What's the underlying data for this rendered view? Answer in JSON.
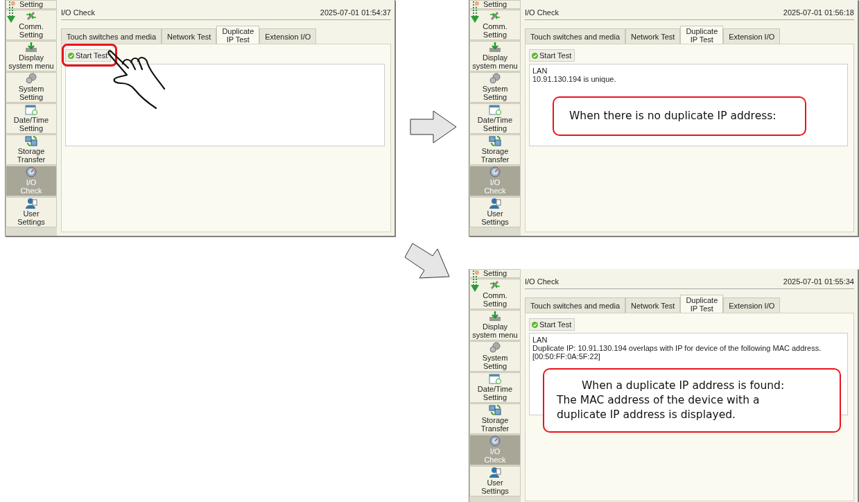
{
  "screens": [
    {
      "title": "I/O Check",
      "datetime": "2025-07-01  01:54:37",
      "sidebar": {
        "items": [
          {
            "label": "Setting",
            "selected": false
          },
          {
            "label": "Comm.\nSetting",
            "selected": false
          },
          {
            "label": "Display\nsystem menu",
            "selected": false
          },
          {
            "label": "System\nSetting",
            "selected": false
          },
          {
            "label": "Date/Time\nSetting",
            "selected": false
          },
          {
            "label": "Storage\nTransfer",
            "selected": false
          },
          {
            "label": "I/O\nCheck",
            "selected": true
          },
          {
            "label": "User\nSettings",
            "selected": false
          }
        ]
      },
      "tabs": [
        {
          "label": "Touch switches and media",
          "selected": false
        },
        {
          "label": "Network Test",
          "selected": false
        },
        {
          "label": "Duplicate\nIP Test",
          "selected": true
        },
        {
          "label": "Extension I/O",
          "selected": false
        }
      ],
      "start_button": {
        "label": "Start Test",
        "highlighted": true
      },
      "tapped": true
    },
    {
      "title": "I/O Check",
      "datetime": "2025-07-01  01:56:18",
      "sidebar": {
        "items": [
          {
            "label": "Setting",
            "selected": false
          },
          {
            "label": "Comm.\nSetting",
            "selected": false
          },
          {
            "label": "Display\nsystem menu",
            "selected": false
          },
          {
            "label": "System\nSetting",
            "selected": false
          },
          {
            "label": "Date/Time\nSetting",
            "selected": false
          },
          {
            "label": "Storage\nTransfer",
            "selected": false
          },
          {
            "label": "I/O\nCheck",
            "selected": true
          },
          {
            "label": "User\nSettings",
            "selected": false
          }
        ]
      },
      "tabs": [
        {
          "label": "Touch switches and media",
          "selected": false
        },
        {
          "label": "Network Test",
          "selected": false
        },
        {
          "label": "Duplicate\nIP Test",
          "selected": true
        },
        {
          "label": "Extension I/O",
          "selected": false
        }
      ],
      "start_button": {
        "label": "Start Test",
        "highlighted": false
      },
      "tapped": false,
      "result_lines": [
        "LAN",
        "10.91.130.194 is unique."
      ],
      "callout": "When there is no duplicate IP address:"
    },
    {
      "title": "I/O Check",
      "datetime": "2025-07-01  01:55:34",
      "sidebar": {
        "items": [
          {
            "label": "Setting",
            "selected": false
          },
          {
            "label": "Comm.\nSetting",
            "selected": false
          },
          {
            "label": "Display\nsystem menu",
            "selected": false
          },
          {
            "label": "System\nSetting",
            "selected": false
          },
          {
            "label": "Date/Time\nSetting",
            "selected": false
          },
          {
            "label": "Storage\nTransfer",
            "selected": false
          },
          {
            "label": "I/O\nCheck",
            "selected": true
          },
          {
            "label": "User\nSettings",
            "selected": false
          }
        ]
      },
      "tabs": [
        {
          "label": "Touch switches and media",
          "selected": false
        },
        {
          "label": "Network Test",
          "selected": false
        },
        {
          "label": "Duplicate\nIP Test",
          "selected": true
        },
        {
          "label": "Extension I/O",
          "selected": false
        }
      ],
      "start_button": {
        "label": "Start Test",
        "highlighted": false
      },
      "tapped": false,
      "result_lines": [
        "LAN",
        "Duplicate IP: 10.91.130.194 overlaps with IP for device of the following MAC address.",
        "[00:50:FF:0A:5F:22]"
      ],
      "callout": "When a duplicate IP address is found:\nThe MAC address of the device with a\nduplicate IP address is displayed."
    }
  ],
  "arrows": [
    {
      "kind": "right"
    },
    {
      "kind": "down-right"
    }
  ]
}
